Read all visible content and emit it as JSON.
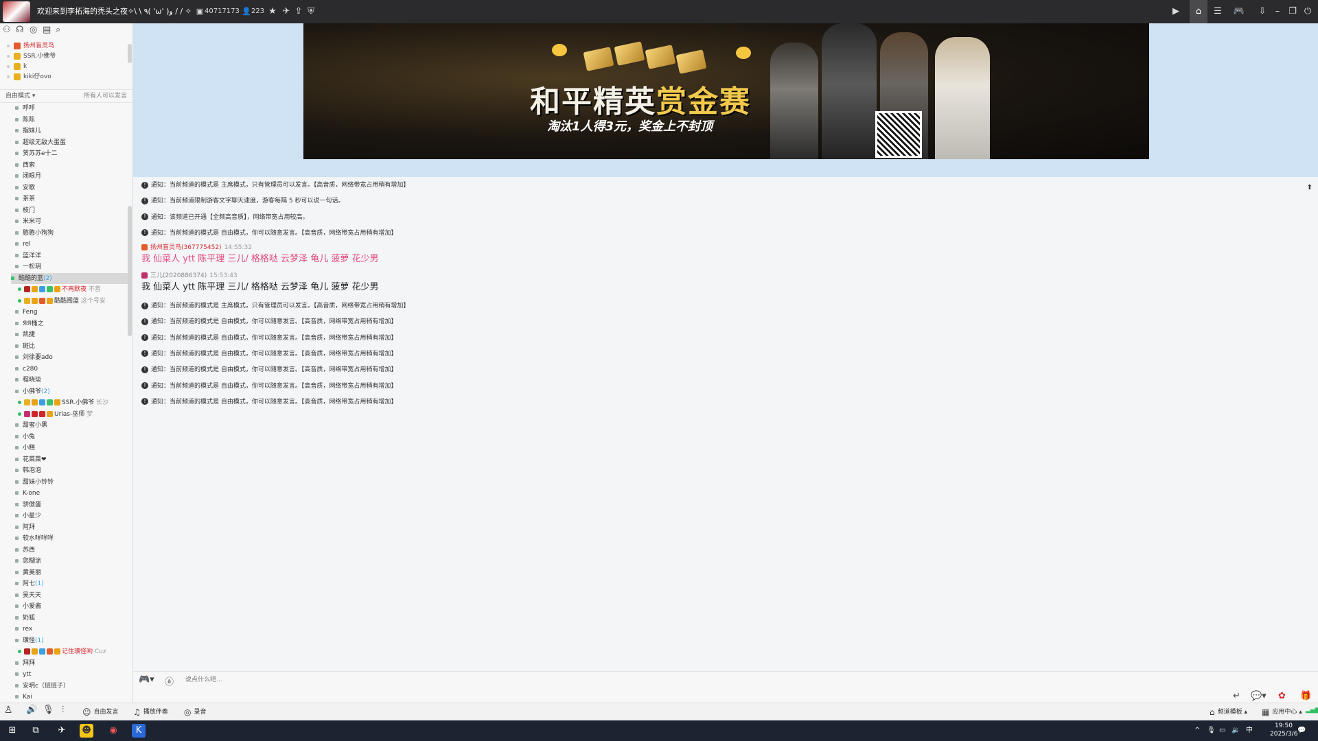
{
  "titlebar": {
    "title": "欢迎来到李拓海的秃头之夜✧\\ \\ ٩( 'ω' )و / / ✧",
    "channel_id": "40717173",
    "online_count": "223"
  },
  "admins": [
    {
      "name": "扬州盲灵鸟",
      "color": "#d0262c"
    },
    {
      "name": "SSR.小佛爷",
      "color": "#444"
    },
    {
      "name": "k",
      "color": "#444"
    },
    {
      "name": "kiki仔ovo",
      "color": "#444"
    }
  ],
  "sidebar": {
    "mode_label": "自由模式",
    "mode_right": "所有人可以发言",
    "channels_top": [
      "呼呼",
      "陈陈",
      "指妹儿",
      "超级无敌大蛋蛋",
      "贺苏苏e十二",
      "西索",
      "闭眼月",
      "安歌",
      "茶茶",
      "枝门",
      "米米可",
      "憨憨小狗狗",
      "rel",
      "蓝洋洋",
      "一松玥"
    ],
    "selected_channel": {
      "name": "酷酷的蓝",
      "count": "(2)"
    },
    "selected_users": [
      {
        "name": "不再默夜",
        "sig": "不善"
      },
      {
        "name": "酷酷阁蓝",
        "sig": "这个号安"
      }
    ],
    "channels_mid": [
      "Feng",
      "ЯЯ桶之",
      "凯捷",
      "斑比",
      "刘徐要ado",
      "c280",
      "程晓琰"
    ],
    "xiaofu": {
      "name": "小佛爷",
      "count": "(2)"
    },
    "xiaofu_users": [
      {
        "name": "SSR.小佛爷",
        "sig": "长沙"
      },
      {
        "name": "Urias-巫师",
        "sig": "梦"
      }
    ],
    "channels_bottom": [
      "甜蜜小黑",
      "小兔",
      "小糕",
      "花菜菜❤",
      "韩泡泡",
      "甜妹小铃铃",
      "K-one",
      "骄傲蛋",
      "小星少",
      "阿拜",
      "软水咩咩咩",
      "苏西",
      "您糊涂",
      "黄美丽"
    ],
    "ahqi": {
      "name": "阿七",
      "count": "(1)"
    },
    "channels_bottom2": [
      "吴天天",
      "小爱酱",
      "奶狐",
      "rex"
    ],
    "huanyu": {
      "name": "璜怪",
      "count": "(1)"
    },
    "huanyu_user": {
      "name": "记住璜怪哟",
      "sig": "Cuz"
    },
    "channels_last": [
      "拜拜",
      "ytt",
      "安玥c（班班子）",
      "Kai"
    ]
  },
  "banner": {
    "title_white": "和平精英",
    "title_gold": "赏金赛",
    "subtitle": "淘汰1人得3元，奖金上不封顶"
  },
  "chat": {
    "notices_top": [
      "通知：当前频道的模式是 主席模式，只有管理员可以发言。【高音质，网络带宽占用稍有增加】",
      "通知：当前频道限制游客文字聊天速度，游客每隔 5 秒可以说一句话。",
      "通知：该频道已开通【全频高音质】，网络带宽占用较高。",
      "通知：当前频道的模式是 自由模式，你可以随意发言。【高音质，网络带宽占用稍有增加】"
    ],
    "msg1": {
      "author": "扬州盲灵鸟(367775452)",
      "time": "14:55:32",
      "text": "我 仙菜人 ytt 陈平理 三儿/ 格格哒 云梦泽 龟儿 菠萝 花少男"
    },
    "msg2": {
      "author": "三儿(2020886374)",
      "time": "15:53:43",
      "text": "我 仙菜人 ytt 陈平理 三儿/ 格格哒 云梦泽 龟儿 菠萝 花少男"
    },
    "notices_bottom": [
      "通知：当前频道的模式是 主席模式，只有管理员可以发言。【高音质，网络带宽占用稍有增加】",
      "通知：当前频道的模式是 自由模式，你可以随意发言。【高音质，网络带宽占用稍有增加】",
      "通知：当前频道的模式是 自由模式，你可以随意发言。【高音质，网络带宽占用稍有增加】",
      "通知：当前频道的模式是 自由模式，你可以随意发言。【高音质，网络带宽占用稍有增加】",
      "通知：当前频道的模式是 自由模式，你可以随意发言。【高音质，网络带宽占用稍有增加】",
      "通知：当前频道的模式是 自由模式，你可以随意发言。【高音质，网络带宽占用稍有增加】",
      "通知：当前频道的模式是 自由模式，你可以随意发言。【高音质，网络带宽占用稍有增加】"
    ]
  },
  "input": {
    "placeholder": "说点什么吧..."
  },
  "toolbar": {
    "free_speak": "自由发言",
    "play_music": "播放伴奏",
    "record": "录音",
    "template": "频道模板",
    "app_center": "应用中心"
  },
  "taskbar": {
    "time": "19:50",
    "date": "2025/3/6",
    "ime": "中"
  },
  "colors": {
    "accent_red": "#d0262c",
    "pink_msg": "#e0497a",
    "banner_bg": "#cfe3f4"
  }
}
